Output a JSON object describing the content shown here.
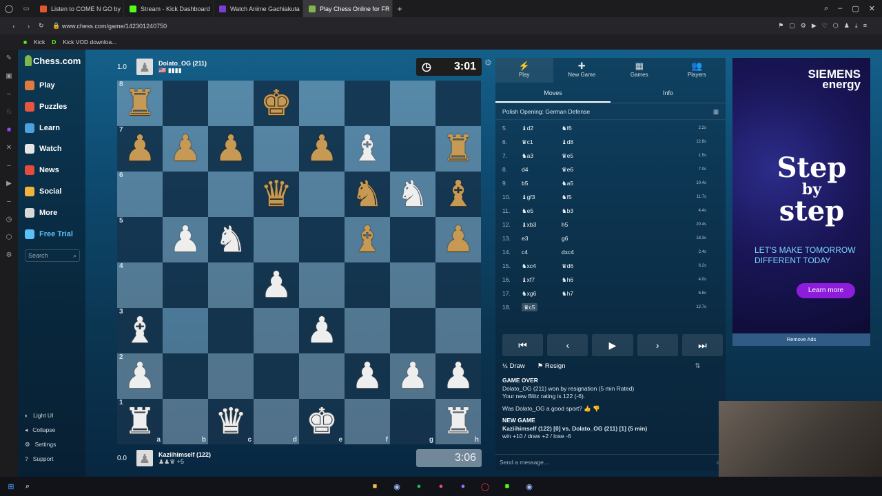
{
  "browser": {
    "tabs": [
      {
        "label": "Listen to COME N GO by",
        "color": "#e4572e"
      },
      {
        "label": "Stream - Kick Dashboard",
        "color": "#53fc18"
      },
      {
        "label": "Watch Anime Gachiakuta",
        "color": "#7a3fd0"
      },
      {
        "label": "Play Chess Online for FR",
        "color": "#81b64c"
      }
    ],
    "url": "www.chess.com/game/142301240750",
    "bookmarks": [
      "Kick",
      "Kick VOD downloa..."
    ]
  },
  "site": {
    "logo": "Chess.com",
    "nav": [
      {
        "label": "Play",
        "icon": "play-hand-icon",
        "color": "#e07a3e"
      },
      {
        "label": "Puzzles",
        "icon": "puzzle-icon",
        "color": "#e8553e"
      },
      {
        "label": "Learn",
        "icon": "learn-icon",
        "color": "#4aa3df"
      },
      {
        "label": "Watch",
        "icon": "watch-icon",
        "color": "#e6e6e6"
      },
      {
        "label": "News",
        "icon": "news-icon",
        "color": "#e84a3e"
      },
      {
        "label": "Social",
        "icon": "social-icon",
        "color": "#f2b33d"
      },
      {
        "label": "More",
        "icon": "more-icon",
        "color": "#d8d8d8"
      },
      {
        "label": "Free Trial",
        "icon": "diamond-icon",
        "color": "#5bc0f8"
      }
    ],
    "search_placeholder": "Search",
    "bottom_nav": [
      "Light UI",
      "Collapse",
      "Settings",
      "Support"
    ]
  },
  "game": {
    "top": {
      "score": "1.0",
      "name": "Dolato_OG (211)",
      "clock": "3:01"
    },
    "bottom": {
      "score": "0.0",
      "name": "Kaziihimself (122)",
      "clock": "3:06",
      "material": "+5"
    },
    "ranks": [
      "8",
      "7",
      "6",
      "5",
      "4",
      "3",
      "2",
      "1"
    ],
    "files": [
      "a",
      "b",
      "c",
      "d",
      "e",
      "f",
      "g",
      "h"
    ],
    "board": [
      [
        "bR",
        "",
        "",
        "bK",
        "",
        "",
        "",
        ""
      ],
      [
        "bP",
        "bP",
        "bP",
        "",
        "bP",
        "wB",
        "",
        "bR"
      ],
      [
        "",
        "",
        "",
        "bQ",
        "",
        "bN",
        "wN",
        "bB"
      ],
      [
        "",
        "wP",
        "wN",
        "",
        "",
        "bB",
        "",
        "bP"
      ],
      [
        "",
        "",
        "",
        "wP",
        "",
        "",
        "",
        ""
      ],
      [
        "wB",
        "",
        "",
        "",
        "wP",
        "",
        "",
        ""
      ],
      [
        "wP",
        "",
        "",
        "",
        "",
        "wP",
        "wP",
        "wP"
      ],
      [
        "wR",
        "",
        "wQ",
        "",
        "wK",
        "",
        "",
        "wR"
      ]
    ],
    "highlight": [
      [
        5,
        1
      ]
    ]
  },
  "panel": {
    "tabs": [
      {
        "label": "Play",
        "icon": "⚡"
      },
      {
        "label": "New Game",
        "icon": "✚"
      },
      {
        "label": "Games",
        "icon": "▦"
      },
      {
        "label": "Players",
        "icon": "👥"
      }
    ],
    "subtabs": [
      "Moves",
      "Info"
    ],
    "opening": "Polish Opening: German Defense",
    "moves": [
      {
        "n": "5.",
        "w": "♝d2",
        "b": "♞f6",
        "t": "2.2s"
      },
      {
        "n": "6.",
        "w": "♛c1",
        "b": "♝d8",
        "t": "12.8s"
      },
      {
        "n": "7.",
        "w": "♞a3",
        "b": "♛e5",
        "t": "1.5s"
      },
      {
        "n": "8.",
        "w": "d4",
        "b": "♛e6",
        "t": "7.0s"
      },
      {
        "n": "9.",
        "w": "b5",
        "b": "♞a5",
        "t": "10.4s"
      },
      {
        "n": "10.",
        "w": "♝gf3",
        "b": "♞f5",
        "t": "11.7s"
      },
      {
        "n": "11.",
        "w": "♞e5",
        "b": "♞b3",
        "t": "4.4s"
      },
      {
        "n": "12.",
        "w": "♝xb3",
        "b": "h5",
        "t": "20.4s"
      },
      {
        "n": "13.",
        "w": "e3",
        "b": "g6",
        "t": "18.3s"
      },
      {
        "n": "14.",
        "w": "c4",
        "b": "dxc4",
        "t": "2.4s"
      },
      {
        "n": "15.",
        "w": "♞xc4",
        "b": "♛d6",
        "t": "6.2s"
      },
      {
        "n": "16.",
        "w": "♝xf7",
        "b": "♞h6",
        "t": "4.0s"
      },
      {
        "n": "17.",
        "w": "♞xg6",
        "b": "♞h7",
        "t": "6.8s"
      },
      {
        "n": "18.",
        "w": "♛c5",
        "b": "",
        "t": "12.7s"
      }
    ],
    "draw": "Draw",
    "resign": "Resign",
    "log": {
      "over_title": "GAME OVER",
      "over_text": "Dolato_OG (211) won by resignation (5 min Rated)",
      "rating": "Your new Blitz rating is 122 (-6).",
      "sport": "Was Dolato_OG a good sport?",
      "new_title": "NEW GAME",
      "new_text": "Kaziihimself (122) [0] vs. Dolato_OG (211) [1] (5 min)",
      "odds": "win +10 / draw +2 / lose -6"
    },
    "message_placeholder": "Send a message..."
  },
  "ad": {
    "brand1": "SIEMENS",
    "brand2": "energy",
    "w1": "Step",
    "w2": "by",
    "w3": "step",
    "tag": "LET'S MAKE TOMORROW DIFFERENT TODAY",
    "cta": "Learn more",
    "remove": "Remove Ads"
  }
}
